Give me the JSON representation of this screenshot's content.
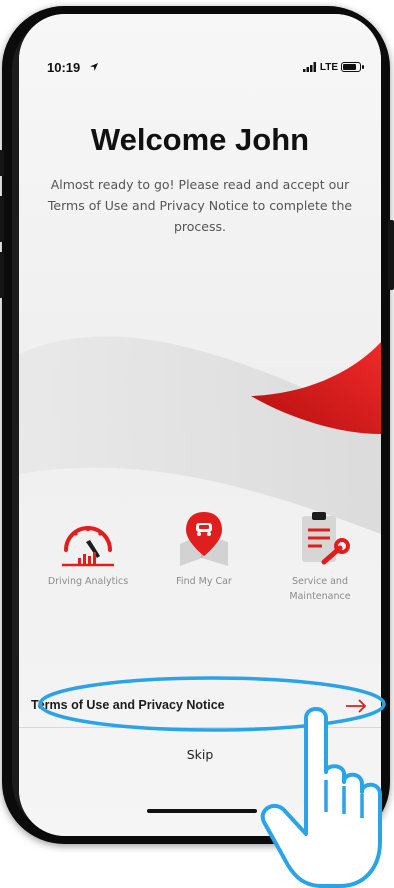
{
  "status_bar": {
    "time": "10:19",
    "network": "LTE",
    "icons": [
      "location-arrow-icon",
      "signal-bars-icon",
      "battery-icon"
    ]
  },
  "welcome": {
    "title": "Welcome John",
    "message": "Almost ready to go! Please read and accept our Terms of Use and Privacy Notice to complete the process."
  },
  "features": [
    {
      "label": "Driving Analytics",
      "icon": "speedometer-icon"
    },
    {
      "label": "Find My Car",
      "icon": "map-pin-car-icon"
    },
    {
      "label": "Service and Maintenance",
      "icon": "clipboard-wrench-icon"
    }
  ],
  "terms": {
    "label": "Terms of Use and Privacy Notice",
    "arrow_icon": "arrow-right-icon"
  },
  "skip_label": "Skip",
  "colors": {
    "brand_red": "#e01e1e",
    "highlight_blue": "#2aa4e6",
    "text_dark": "#111111",
    "text_muted": "#555555"
  }
}
